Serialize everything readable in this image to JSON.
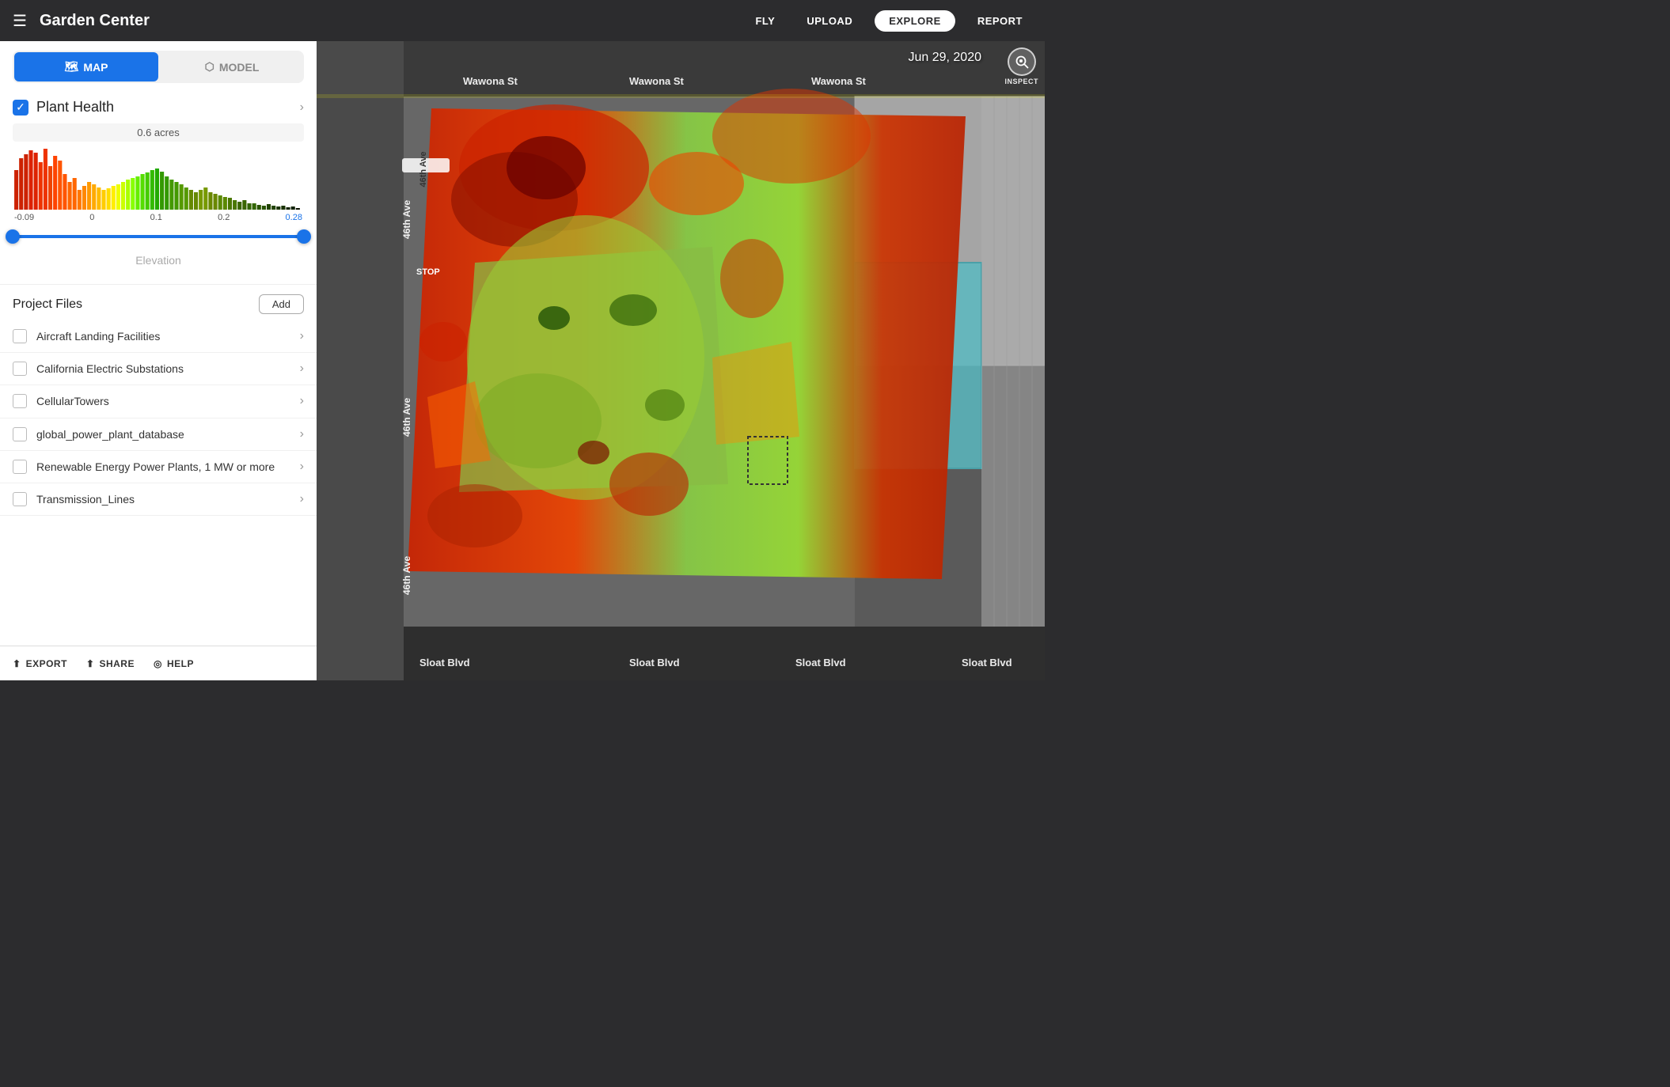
{
  "app": {
    "title": "Garden Center",
    "hamburger_icon": "☰"
  },
  "topnav": {
    "fly": "FLY",
    "upload": "UPLOAD",
    "explore": "EXPLORE",
    "report": "REPORT"
  },
  "sidebar": {
    "map_btn": "MAP",
    "model_btn": "MODEL",
    "plant_health": {
      "label": "Plant Health",
      "acres": "0.6 acres",
      "scale_min": "-0.09",
      "scale_zero": "0",
      "scale_01": "0.1",
      "scale_02": "0.2",
      "scale_max": "0.28"
    },
    "elevation_label": "Elevation",
    "project_files": {
      "title": "Project Files",
      "add_btn": "Add",
      "items": [
        {
          "name": "Aircraft Landing Facilities"
        },
        {
          "name": "California Electric Substations"
        },
        {
          "name": "CellularTowers"
        },
        {
          "name": "global_power_plant_database"
        },
        {
          "name": "Renewable Energy Power Plants,\n1 MW or more"
        },
        {
          "name": "Transmission_Lines"
        }
      ]
    },
    "bottom": {
      "export": "EXPORT",
      "share": "SHARE",
      "help": "HELP"
    }
  },
  "map": {
    "date": "Jun 29, 2020",
    "inspect_label": "INSPECT",
    "street_labels": [
      "Wawona St",
      "Wawona St",
      "Wawona St",
      "46th Ave",
      "46th Ave",
      "46th Ave",
      "Sloat Blvd",
      "Sloat Blvd",
      "Sloat Blvd",
      "Sloat Blvd"
    ]
  },
  "icons": {
    "hamburger": "☰",
    "map_icon": "🗺",
    "model_icon": "⬡",
    "checkmark": "✓",
    "chevron_right": "›",
    "chevron_left": "‹",
    "search_zoom": "🔍",
    "export_icon": "⬆",
    "share_icon": "⬆",
    "help_icon": "◎"
  }
}
